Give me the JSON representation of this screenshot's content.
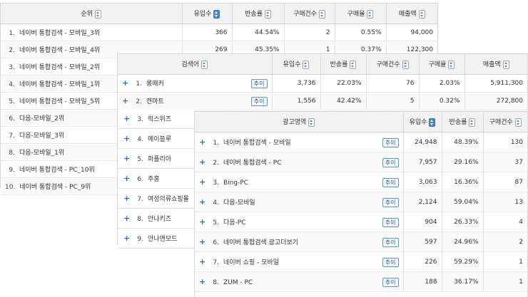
{
  "panel1": {
    "headers": [
      "순위",
      "유입수",
      "반송률",
      "구매건수",
      "구매율",
      "매출액"
    ],
    "rows": [
      {
        "rank": "1.",
        "name": "네이버 통합검색 - 모바일_3위",
        "visits": "366",
        "bounce": "44.54%",
        "orders": "2",
        "rate": "0.55%",
        "sales": "94,000"
      },
      {
        "rank": "2.",
        "name": "네이버 통합검색 - 모바일_4위",
        "visits": "269",
        "bounce": "45.35%",
        "orders": "1",
        "rate": "0.37%",
        "sales": "122,300"
      },
      {
        "rank": "3.",
        "name": "네이버 통합검색 - 모바일_2위"
      },
      {
        "rank": "4.",
        "name": "네이버 통합검색 - 모바일_1위"
      },
      {
        "rank": "5.",
        "name": "네이버 통합검색 - 모바일_5위"
      },
      {
        "rank": "6.",
        "name": "다음-모바일_2위"
      },
      {
        "rank": "7.",
        "name": "다음-모바일_3위"
      },
      {
        "rank": "8.",
        "name": "다음-모바일_1위"
      },
      {
        "rank": "9.",
        "name": "네이버 통합검색 - PC_10위"
      },
      {
        "rank": "10.",
        "name": "네이버 통합검색 - PC_9위"
      }
    ]
  },
  "panel2": {
    "headers": [
      "검색어",
      "유입수",
      "반송률",
      "구매건수",
      "구매율",
      "매출액"
    ],
    "trend_label": "추이",
    "rows": [
      {
        "rank": "1.",
        "name": "롱패커",
        "visits": "3,736",
        "bounce": "22.03%",
        "orders": "76",
        "rate": "2.03%",
        "sales": "5,911,300"
      },
      {
        "rank": "2.",
        "name": "캔마트",
        "visits": "1,556",
        "bounce": "42.42%",
        "orders": "5",
        "rate": "0.32%",
        "sales": "272,800"
      }
    ],
    "side_items": [
      {
        "rank": "3.",
        "name": "럭스위즈"
      },
      {
        "rank": "4.",
        "name": "메이블루"
      },
      {
        "rank": "5.",
        "name": "퍼플리아"
      },
      {
        "rank": "6.",
        "name": "주홍"
      },
      {
        "rank": "7.",
        "name": "여성의류쇼핑몰"
      },
      {
        "rank": "8.",
        "name": "안나키즈"
      },
      {
        "rank": "9.",
        "name": "안나앤모드"
      }
    ]
  },
  "panel3": {
    "headers": [
      "광고영역",
      "유입수",
      "반송률",
      "구매건수"
    ],
    "trend_label": "추이",
    "rows": [
      {
        "rank": "1.",
        "name": "네이버 통합검색 - 모바일",
        "visits": "24,948",
        "bounce": "48.39%",
        "orders": "130"
      },
      {
        "rank": "2.",
        "name": "네이버 통합검색 - PC",
        "visits": "7,957",
        "bounce": "29.16%",
        "orders": "37"
      },
      {
        "rank": "3.",
        "name": "Bing-PC",
        "visits": "3,063",
        "bounce": "16.36%",
        "orders": "87"
      },
      {
        "rank": "4.",
        "name": "다음-모바일",
        "visits": "2,124",
        "bounce": "59.04%",
        "orders": "13"
      },
      {
        "rank": "5.",
        "name": "다음-PC",
        "visits": "904",
        "bounce": "26.33%",
        "orders": "4"
      },
      {
        "rank": "6.",
        "name": "네이버 통합검색 광고더보기",
        "visits": "597",
        "bounce": "24.96%",
        "orders": "2"
      },
      {
        "rank": "7.",
        "name": "네이버 쇼핑 - 모바일",
        "visits": "226",
        "bounce": "59.29%",
        "orders": "1"
      },
      {
        "rank": "8.",
        "name": "ZUM - PC",
        "visits": "188",
        "bounce": "36.17%",
        "orders": "1"
      }
    ]
  }
}
